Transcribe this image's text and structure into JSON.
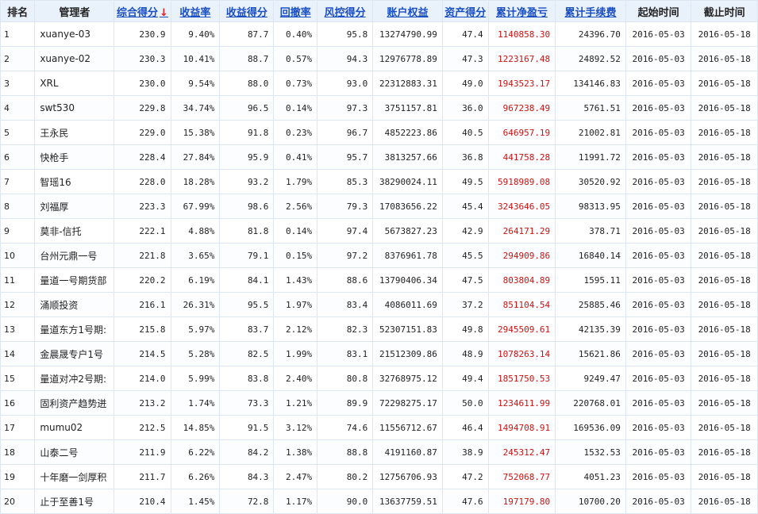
{
  "header": {
    "rank": "排名",
    "manager": "管理者",
    "composite": "综合得分",
    "return_rate": "收益率",
    "return_score": "收益得分",
    "drawdown": "回撤率",
    "risk_score": "风控得分",
    "equity": "账户权益",
    "asset_score": "资产得分",
    "cum_pnl": "累计净盈亏",
    "cum_fee": "累计手续费",
    "start": "起始时间",
    "end": "截止时间",
    "sort_arrow": "↓"
  },
  "sort_column_color": "#1a4fc4",
  "pnl_color": "#d01010",
  "rows": [
    {
      "rank": "1",
      "name": "xuanye-03",
      "composite": "230.9",
      "return_rate": "9.40%",
      "return_score": "87.7",
      "drawdown": "0.40%",
      "risk_score": "95.8",
      "equity": "13274790.99",
      "asset_score": "47.4",
      "cum_pnl": "1140858.30",
      "cum_fee": "24396.70",
      "start": "2016-05-03",
      "end": "2016-05-18"
    },
    {
      "rank": "2",
      "name": "xuanye-02",
      "composite": "230.3",
      "return_rate": "10.41%",
      "return_score": "88.7",
      "drawdown": "0.57%",
      "risk_score": "94.3",
      "equity": "12976778.89",
      "asset_score": "47.3",
      "cum_pnl": "1223167.48",
      "cum_fee": "24892.52",
      "start": "2016-05-03",
      "end": "2016-05-18"
    },
    {
      "rank": "3",
      "name": "XRL",
      "composite": "230.0",
      "return_rate": "9.54%",
      "return_score": "88.0",
      "drawdown": "0.73%",
      "risk_score": "93.0",
      "equity": "22312883.31",
      "asset_score": "49.0",
      "cum_pnl": "1943523.17",
      "cum_fee": "134146.83",
      "start": "2016-05-03",
      "end": "2016-05-18"
    },
    {
      "rank": "4",
      "name": "swt530",
      "composite": "229.8",
      "return_rate": "34.74%",
      "return_score": "96.5",
      "drawdown": "0.14%",
      "risk_score": "97.3",
      "equity": "3751157.81",
      "asset_score": "36.0",
      "cum_pnl": "967238.49",
      "cum_fee": "5761.51",
      "start": "2016-05-03",
      "end": "2016-05-18"
    },
    {
      "rank": "5",
      "name": "王永民",
      "composite": "229.0",
      "return_rate": "15.38%",
      "return_score": "91.8",
      "drawdown": "0.23%",
      "risk_score": "96.7",
      "equity": "4852223.86",
      "asset_score": "40.5",
      "cum_pnl": "646957.19",
      "cum_fee": "21002.81",
      "start": "2016-05-03",
      "end": "2016-05-18"
    },
    {
      "rank": "6",
      "name": "快枪手",
      "composite": "228.4",
      "return_rate": "27.84%",
      "return_score": "95.9",
      "drawdown": "0.41%",
      "risk_score": "95.7",
      "equity": "3813257.66",
      "asset_score": "36.8",
      "cum_pnl": "441758.28",
      "cum_fee": "11991.72",
      "start": "2016-05-03",
      "end": "2016-05-18"
    },
    {
      "rank": "7",
      "name": "智瑶16",
      "composite": "228.0",
      "return_rate": "18.28%",
      "return_score": "93.2",
      "drawdown": "1.79%",
      "risk_score": "85.3",
      "equity": "38290024.11",
      "asset_score": "49.5",
      "cum_pnl": "5918989.08",
      "cum_fee": "30520.92",
      "start": "2016-05-03",
      "end": "2016-05-18"
    },
    {
      "rank": "8",
      "name": "刘福厚",
      "composite": "223.3",
      "return_rate": "67.99%",
      "return_score": "98.6",
      "drawdown": "2.56%",
      "risk_score": "79.3",
      "equity": "17083656.22",
      "asset_score": "45.4",
      "cum_pnl": "3243646.05",
      "cum_fee": "98313.95",
      "start": "2016-05-03",
      "end": "2016-05-18"
    },
    {
      "rank": "9",
      "name": "莫非-信托",
      "composite": "222.1",
      "return_rate": "4.88%",
      "return_score": "81.8",
      "drawdown": "0.14%",
      "risk_score": "97.4",
      "equity": "5673827.23",
      "asset_score": "42.9",
      "cum_pnl": "264171.29",
      "cum_fee": "378.71",
      "start": "2016-05-03",
      "end": "2016-05-18"
    },
    {
      "rank": "10",
      "name": "台州元鼎一号",
      "composite": "221.8",
      "return_rate": "3.65%",
      "return_score": "79.1",
      "drawdown": "0.15%",
      "risk_score": "97.2",
      "equity": "8376961.78",
      "asset_score": "45.5",
      "cum_pnl": "294909.86",
      "cum_fee": "16840.14",
      "start": "2016-05-03",
      "end": "2016-05-18"
    },
    {
      "rank": "11",
      "name": "量道一号期货部",
      "composite": "220.2",
      "return_rate": "6.19%",
      "return_score": "84.1",
      "drawdown": "1.43%",
      "risk_score": "88.6",
      "equity": "13790406.34",
      "asset_score": "47.5",
      "cum_pnl": "803804.89",
      "cum_fee": "1595.11",
      "start": "2016-05-03",
      "end": "2016-05-18"
    },
    {
      "rank": "12",
      "name": "涌顺投资",
      "composite": "216.1",
      "return_rate": "26.31%",
      "return_score": "95.5",
      "drawdown": "1.97%",
      "risk_score": "83.4",
      "equity": "4086011.69",
      "asset_score": "37.2",
      "cum_pnl": "851104.54",
      "cum_fee": "25885.46",
      "start": "2016-05-03",
      "end": "2016-05-18"
    },
    {
      "rank": "13",
      "name": "量道东方1号期:",
      "composite": "215.8",
      "return_rate": "5.97%",
      "return_score": "83.7",
      "drawdown": "2.12%",
      "risk_score": "82.3",
      "equity": "52307151.83",
      "asset_score": "49.8",
      "cum_pnl": "2945509.61",
      "cum_fee": "42135.39",
      "start": "2016-05-03",
      "end": "2016-05-18"
    },
    {
      "rank": "14",
      "name": "金晨晟专户1号",
      "composite": "214.5",
      "return_rate": "5.28%",
      "return_score": "82.5",
      "drawdown": "1.99%",
      "risk_score": "83.1",
      "equity": "21512309.86",
      "asset_score": "48.9",
      "cum_pnl": "1078263.14",
      "cum_fee": "15621.86",
      "start": "2016-05-03",
      "end": "2016-05-18"
    },
    {
      "rank": "15",
      "name": "量道对冲2号期:",
      "composite": "214.0",
      "return_rate": "5.99%",
      "return_score": "83.8",
      "drawdown": "2.40%",
      "risk_score": "80.8",
      "equity": "32768975.12",
      "asset_score": "49.4",
      "cum_pnl": "1851750.53",
      "cum_fee": "9249.47",
      "start": "2016-05-03",
      "end": "2016-05-18"
    },
    {
      "rank": "16",
      "name": "固利资产趋势迸",
      "composite": "213.2",
      "return_rate": "1.74%",
      "return_score": "73.3",
      "drawdown": "1.21%",
      "risk_score": "89.9",
      "equity": "72298275.17",
      "asset_score": "50.0",
      "cum_pnl": "1234611.99",
      "cum_fee": "220768.01",
      "start": "2016-05-03",
      "end": "2016-05-18"
    },
    {
      "rank": "17",
      "name": "mumu02",
      "composite": "212.5",
      "return_rate": "14.85%",
      "return_score": "91.5",
      "drawdown": "3.12%",
      "risk_score": "74.6",
      "equity": "11556712.67",
      "asset_score": "46.4",
      "cum_pnl": "1494708.91",
      "cum_fee": "169536.09",
      "start": "2016-05-03",
      "end": "2016-05-18"
    },
    {
      "rank": "18",
      "name": "山泰二号",
      "composite": "211.9",
      "return_rate": "6.22%",
      "return_score": "84.2",
      "drawdown": "1.38%",
      "risk_score": "88.8",
      "equity": "4191160.87",
      "asset_score": "38.9",
      "cum_pnl": "245312.47",
      "cum_fee": "1532.53",
      "start": "2016-05-03",
      "end": "2016-05-18"
    },
    {
      "rank": "19",
      "name": "十年磨一剑厚积",
      "composite": "211.7",
      "return_rate": "6.26%",
      "return_score": "84.3",
      "drawdown": "2.47%",
      "risk_score": "80.2",
      "equity": "12756706.93",
      "asset_score": "47.2",
      "cum_pnl": "752068.77",
      "cum_fee": "4051.23",
      "start": "2016-05-03",
      "end": "2016-05-18"
    },
    {
      "rank": "20",
      "name": "止于至善1号",
      "composite": "210.4",
      "return_rate": "1.45%",
      "return_score": "72.8",
      "drawdown": "1.17%",
      "risk_score": "90.0",
      "equity": "13637759.51",
      "asset_score": "47.6",
      "cum_pnl": "197179.80",
      "cum_fee": "10700.20",
      "start": "2016-05-03",
      "end": "2016-05-18"
    }
  ]
}
